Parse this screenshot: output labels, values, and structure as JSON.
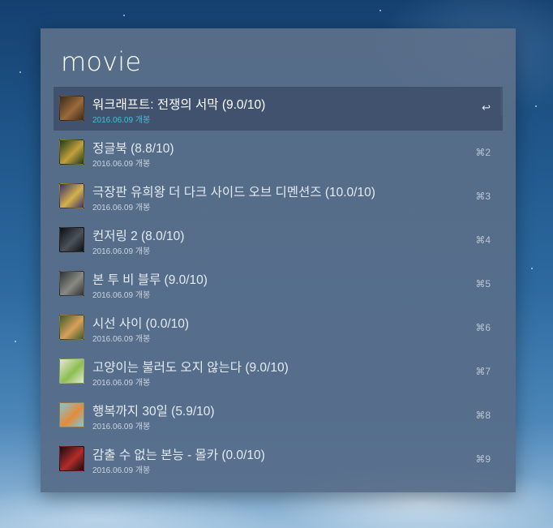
{
  "search": {
    "query": "movie"
  },
  "results": [
    {
      "title": "워크래프트: 전쟁의 서막 (9.0/10)",
      "subtitle": "2016.06.09 개봉",
      "shortcut": "↩",
      "thumb_colors": [
        "#3a2a1c",
        "#9a6b3a"
      ]
    },
    {
      "title": "정글북 (8.8/10)",
      "subtitle": "2016.06.09 개봉",
      "shortcut": "⌘2",
      "thumb_colors": [
        "#1f3a1a",
        "#c2a03c"
      ]
    },
    {
      "title": "극장판 유희왕 더 다크 사이드 오브 디멘션즈 (10.0/10)",
      "subtitle": "2016.06.09 개봉",
      "shortcut": "⌘3",
      "thumb_colors": [
        "#3a2d6e",
        "#d3b24a"
      ]
    },
    {
      "title": "컨저링 2 (8.0/10)",
      "subtitle": "2016.06.09 개봉",
      "shortcut": "⌘4",
      "thumb_colors": [
        "#0c0f12",
        "#4a5259"
      ]
    },
    {
      "title": "본 투 비 블루 (9.0/10)",
      "subtitle": "2016.06.09 개봉",
      "shortcut": "⌘5",
      "thumb_colors": [
        "#2e3134",
        "#8a8a84"
      ]
    },
    {
      "title": "시선 사이 (0.0/10)",
      "subtitle": "2016.06.09 개봉",
      "shortcut": "⌘6",
      "thumb_colors": [
        "#3a5a2a",
        "#d9a05a"
      ]
    },
    {
      "title": "고양이는 불러도 오지 않는다 (9.0/10)",
      "subtitle": "2016.06.09 개봉",
      "shortcut": "⌘7",
      "thumb_colors": [
        "#e9e6d9",
        "#8cbf4f"
      ]
    },
    {
      "title": "행복까지 30일 (5.9/10)",
      "subtitle": "2016.06.09 개봉",
      "shortcut": "⌘8",
      "thumb_colors": [
        "#7ec9d8",
        "#e68a3a"
      ]
    },
    {
      "title": "감출 수 없는 본능 - 몰카 (0.0/10)",
      "subtitle": "2016.06.09 개봉",
      "shortcut": "⌘9",
      "thumb_colors": [
        "#101010",
        "#b52a2a"
      ]
    }
  ],
  "selected_index": 0,
  "colors": {
    "subtitle_selected": "#3bc3d8",
    "selection_bg": "#3c4e68"
  }
}
